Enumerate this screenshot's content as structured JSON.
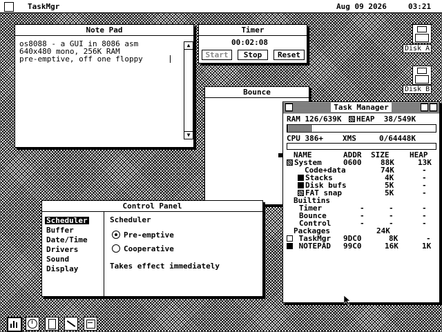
{
  "menubar": {
    "app": "TaskMgr",
    "date": "Aug 09 2026",
    "time": "03:21"
  },
  "notepad": {
    "title": "Note Pad",
    "lines": [
      "os8088 - a GUI in 8086 asm",
      "640x480 mono, 256K RAM",
      "pre-emptive, off one floppy"
    ]
  },
  "timer": {
    "title": "Timer",
    "elapsed": "00:02:08",
    "start": "Start",
    "stop": "Stop",
    "reset": "Reset"
  },
  "bounce": {
    "title": "Bounce"
  },
  "desktop": {
    "disk_a": "Disk A",
    "disk_b": "Disk B"
  },
  "taskmgr": {
    "title": "Task Manager",
    "ram": "RAM 126/639K",
    "heap": "HEAP  38/549K",
    "cpu": "CPU 386+",
    "xms": "XMS     0/64448K",
    "headers": {
      "name": "NAME",
      "addr": "ADDR",
      "size": "SIZE",
      "heap": "HEAP"
    },
    "rows": [
      {
        "name": "System",
        "addr": "0600",
        "size": "88K",
        "heap": "13K"
      },
      {
        "name": "Code+data",
        "addr": "",
        "size": "74K",
        "heap": "-"
      },
      {
        "name": "Stacks",
        "addr": "",
        "size": "4K",
        "heap": "-"
      },
      {
        "name": "Disk bufs",
        "addr": "",
        "size": "5K",
        "heap": "-"
      },
      {
        "name": "FAT snap",
        "addr": "",
        "size": "5K",
        "heap": "-"
      },
      {
        "name": "Builtins",
        "addr": "",
        "size": "",
        "heap": ""
      },
      {
        "name": "Timer",
        "addr": "-",
        "size": "-",
        "heap": "-"
      },
      {
        "name": "Bounce",
        "addr": "-",
        "size": "-",
        "heap": "-"
      },
      {
        "name": "Control",
        "addr": "-",
        "size": "-",
        "heap": "-"
      },
      {
        "name": "Packages",
        "addr": "",
        "size": "24K",
        "heap": ""
      },
      {
        "name": "TaskMgr",
        "addr": "9DC0",
        "size": "8K",
        "heap": "-"
      },
      {
        "name": "NOTEPAD",
        "addr": "99C0",
        "size": "16K",
        "heap": "1K"
      }
    ]
  },
  "control": {
    "title": "Control Panel",
    "items": [
      "Scheduler",
      "Buffer",
      "Date/Time",
      "Drivers",
      "Sound",
      "Display"
    ],
    "heading": "Scheduler",
    "option1": "Pre-emptive",
    "option2": "Cooperative",
    "note": "Takes effect immediately"
  },
  "dock": [
    "taskmgr-icon",
    "timer-icon",
    "notepad-icon",
    "paint-icon",
    "control-icon"
  ]
}
